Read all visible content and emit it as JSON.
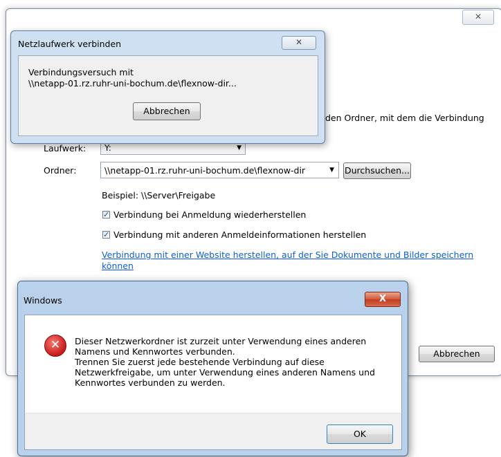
{
  "main_dialog": {
    "close_glyph": "✕",
    "description_fragment": "den Ordner, mit dem die Verbindung",
    "drive_label": "Laufwerk:",
    "drive_value": "Y:",
    "folder_label": "Ordner:",
    "folder_value": "\\\\netapp-01.rz.ruhr-uni-bochum.de\\flexnow-dir",
    "browse_button": "Durchsuchen...",
    "example_text": "Beispiel: \\\\Server\\Freigabe",
    "checkbox_reconnect": "Verbindung bei Anmeldung wiederherstellen",
    "checkbox_other_credentials": "Verbindung mit anderen Anmeldeinformationen herstellen",
    "website_link_line1": "Verbindung mit einer Website herstellen, auf der Sie Dokumente und Bilder speichern",
    "website_link_line2": "können",
    "cancel_button": "Abbrechen"
  },
  "connecting_dialog": {
    "title": "Netzlaufwerk verbinden",
    "close_glyph": "✕",
    "line1": "Verbindungsversuch mit",
    "line2": "\\\\netapp-01.rz.ruhr-uni-bochum.de\\flexnow-dir...",
    "cancel_button": "Abbrechen"
  },
  "error_dialog": {
    "title": "Windows",
    "close_glyph": "X",
    "icon_glyph": "✕",
    "message_lines": [
      "Dieser Netzwerkordner ist zurzeit unter Verwendung eines anderen",
      "Namens und Kennwortes verbunden.",
      "Trennen Sie zuerst jede bestehende Verbindung auf diese",
      "Netzwerkfreigabe, um unter Verwendung eines anderen Namens und",
      "Kennwortes verbunden zu werden."
    ],
    "ok_button": "OK"
  }
}
